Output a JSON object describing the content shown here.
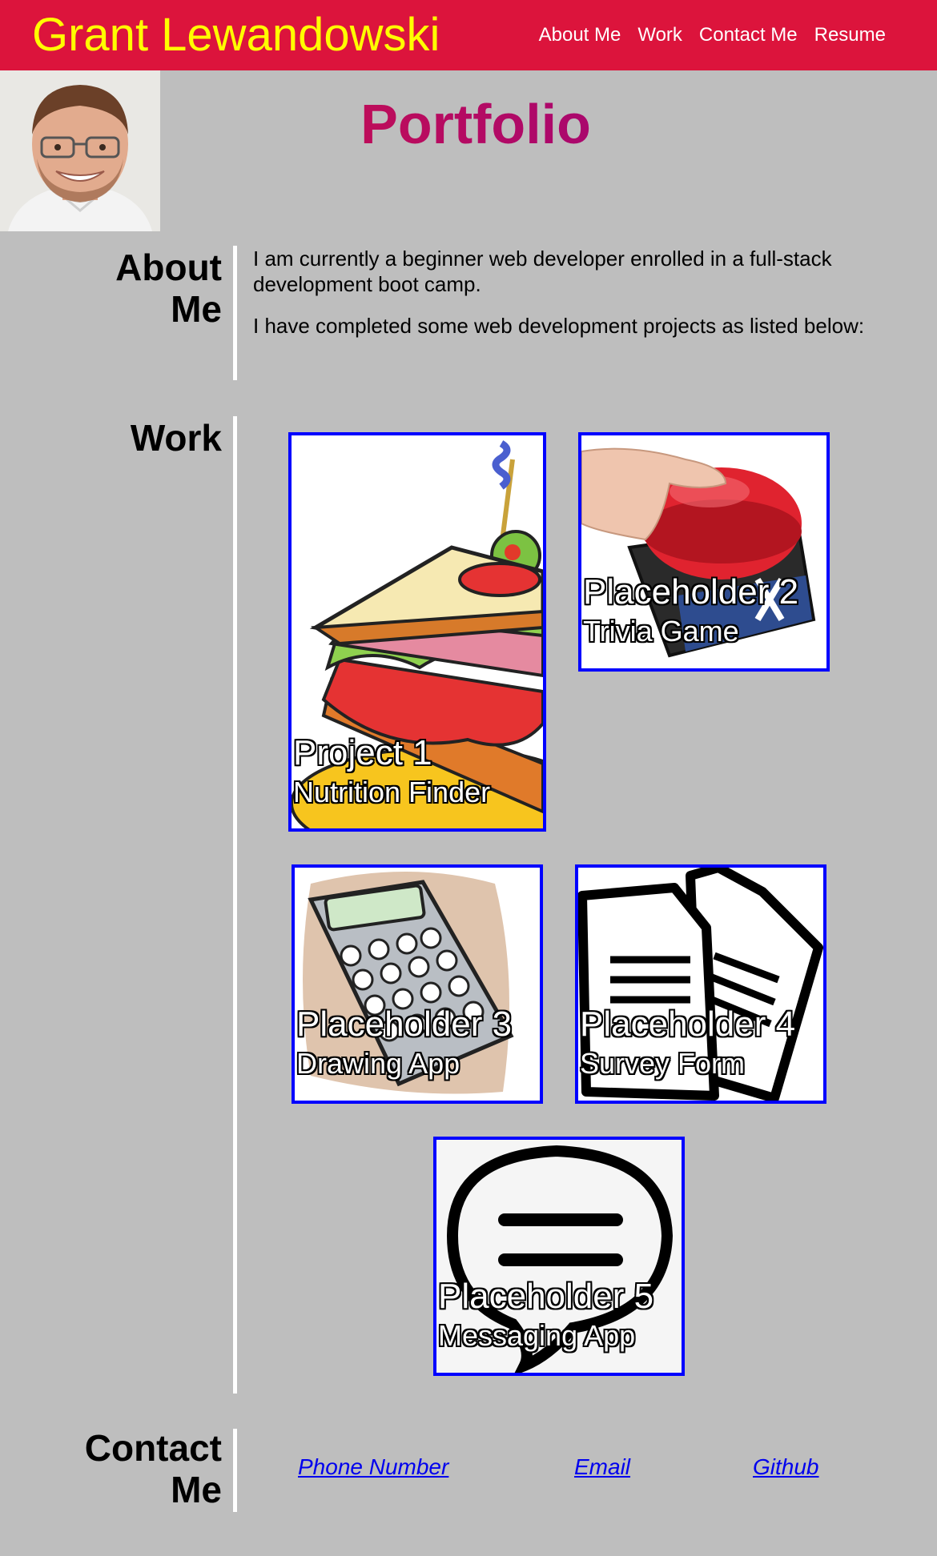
{
  "header": {
    "name": "Grant Lewandowski",
    "nav": [
      "About Me",
      "Work",
      "Contact Me",
      "Resume"
    ]
  },
  "page_title": "Portfolio",
  "about": {
    "title_line1": "About",
    "title_line2": "Me",
    "paragraphs": [
      "I am currently a beginner web developer enrolled in a full-stack development boot camp.",
      "I have completed some web development projects as listed below:"
    ]
  },
  "work": {
    "title": "Work",
    "projects": [
      {
        "title": "Project 1",
        "subtitle": "Nutrition Finder",
        "image": "sandwich-icon"
      },
      {
        "title": "Placeholder 2",
        "subtitle": "Trivia Game",
        "image": "buzzer-icon"
      },
      {
        "title": "Placeholder 3",
        "subtitle": "Drawing App",
        "image": "calculator-icon"
      },
      {
        "title": "Placeholder 4",
        "subtitle": "Survey Form",
        "image": "documents-icon"
      },
      {
        "title": "Placeholder 5",
        "subtitle": "Messaging App",
        "image": "speech-bubble-icon"
      }
    ]
  },
  "contact": {
    "title_line1": "Contact",
    "title_line2": "Me",
    "links": [
      "Phone Number",
      "Email",
      "Github"
    ]
  },
  "colors": {
    "header_bg": "#dc143c",
    "name_color": "#ffff00",
    "page_bg": "#bebebe",
    "card_border": "#0000ff",
    "link_color": "#0000ee"
  }
}
